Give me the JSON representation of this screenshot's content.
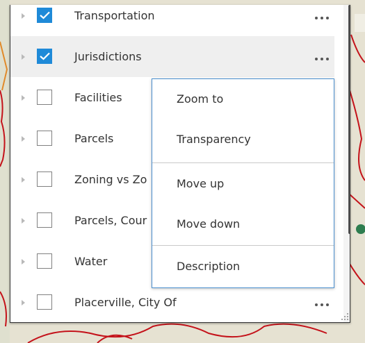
{
  "layers": [
    {
      "label": "Transportation",
      "checked": true,
      "highlighted": false,
      "show_more": true
    },
    {
      "label": "Jurisdictions",
      "checked": true,
      "highlighted": true,
      "show_more": true
    },
    {
      "label": "Facilities",
      "checked": false,
      "highlighted": false,
      "show_more": false
    },
    {
      "label": "Parcels",
      "checked": false,
      "highlighted": false,
      "show_more": false
    },
    {
      "label": "Zoning vs Zo",
      "checked": false,
      "highlighted": false,
      "show_more": false
    },
    {
      "label": "Parcels, Cour",
      "checked": false,
      "highlighted": false,
      "show_more": false
    },
    {
      "label": "Water",
      "checked": false,
      "highlighted": false,
      "show_more": false
    },
    {
      "label": "Placerville, City Of",
      "checked": false,
      "highlighted": false,
      "show_more": true
    }
  ],
  "menu": {
    "items": [
      {
        "label": "Zoom to"
      },
      {
        "label": "Transparency"
      },
      {
        "label": "Move up"
      },
      {
        "label": "Move down"
      },
      {
        "label": "Description"
      }
    ]
  },
  "colors": {
    "checkbox_on": "#1f8ad8",
    "menu_border": "#4a8fcf",
    "row_highlight": "#efefef",
    "map_road": "#c4121a"
  },
  "icons": {
    "expander": "caret-right-icon",
    "checkmark": "checkmark-icon",
    "more": "ellipsis-icon",
    "grip": "resize-grip-icon"
  }
}
